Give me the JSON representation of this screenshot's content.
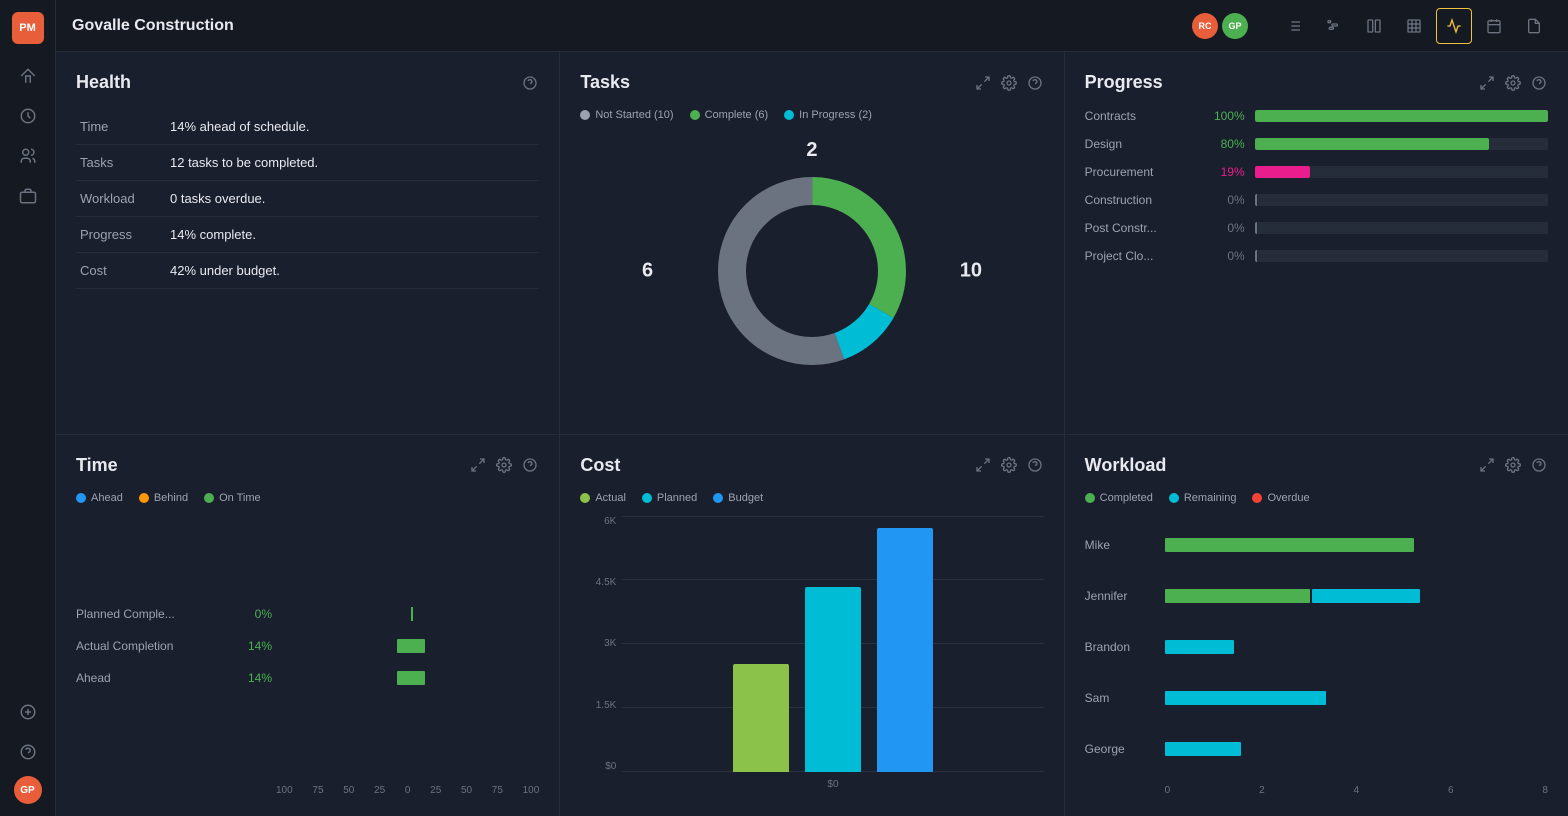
{
  "app": {
    "logo": "PM",
    "title": "Govalle Construction"
  },
  "header": {
    "title": "Govalle Construction",
    "avatars": [
      {
        "initials": "RC",
        "color": "avatar-orange"
      },
      {
        "initials": "GP",
        "color": "avatar-green"
      }
    ],
    "tools": [
      {
        "id": "list",
        "label": "list-view",
        "active": false
      },
      {
        "id": "gantt",
        "label": "gantt-view",
        "active": false
      },
      {
        "id": "board",
        "label": "board-view",
        "active": false
      },
      {
        "id": "table",
        "label": "table-view",
        "active": false
      },
      {
        "id": "pulse",
        "label": "pulse-view",
        "active": true
      },
      {
        "id": "calendar",
        "label": "calendar-view",
        "active": false
      },
      {
        "id": "docs",
        "label": "docs-view",
        "active": false
      }
    ]
  },
  "health": {
    "title": "Health",
    "rows": [
      {
        "label": "Time",
        "value": "14% ahead of schedule."
      },
      {
        "label": "Tasks",
        "value": "12 tasks to be completed."
      },
      {
        "label": "Workload",
        "value": "0 tasks overdue."
      },
      {
        "label": "Progress",
        "value": "14% complete."
      },
      {
        "label": "Cost",
        "value": "42% under budget."
      }
    ]
  },
  "tasks": {
    "title": "Tasks",
    "legend": [
      {
        "label": "Not Started (10)",
        "color": "#9ca3af"
      },
      {
        "label": "Complete (6)",
        "color": "#4caf50"
      },
      {
        "label": "In Progress (2)",
        "color": "#00bcd4"
      }
    ],
    "donut": {
      "not_started": 10,
      "complete": 6,
      "in_progress": 2,
      "total": 18,
      "labels": {
        "left": "6",
        "right": "10",
        "top": "2"
      }
    }
  },
  "progress": {
    "title": "Progress",
    "rows": [
      {
        "label": "Contracts",
        "pct": "100%",
        "pct_class": "green",
        "bar_width": "100%",
        "bar_class": "bar-green"
      },
      {
        "label": "Design",
        "pct": "80%",
        "pct_class": "green",
        "bar_width": "80%",
        "bar_class": "bar-green"
      },
      {
        "label": "Procurement",
        "pct": "19%",
        "pct_class": "pink",
        "bar_width": "19%",
        "bar_class": "bar-pink"
      },
      {
        "label": "Construction",
        "pct": "0%",
        "pct_class": "grey",
        "bar_width": "0%",
        "bar_class": "tick"
      },
      {
        "label": "Post Constr...",
        "pct": "0%",
        "pct_class": "grey",
        "bar_width": "0%",
        "bar_class": "tick"
      },
      {
        "label": "Project Clo...",
        "pct": "0%",
        "pct_class": "grey",
        "bar_width": "0%",
        "bar_class": "tick"
      }
    ]
  },
  "time": {
    "title": "Time",
    "legend": [
      {
        "label": "Ahead",
        "color": "#2196f3"
      },
      {
        "label": "Behind",
        "color": "#ff9800"
      },
      {
        "label": "On Time",
        "color": "#4caf50"
      }
    ],
    "rows": [
      {
        "label": "Planned Comple...",
        "pct": "0%",
        "bar_right_pct": 0
      },
      {
        "label": "Actual Completion",
        "pct": "14%",
        "bar_right_pct": 14
      },
      {
        "label": "Ahead",
        "pct": "14%",
        "bar_right_pct": 14
      }
    ],
    "x_axis": [
      "100",
      "75",
      "50",
      "25",
      "0",
      "25",
      "50",
      "75",
      "100"
    ]
  },
  "cost": {
    "title": "Cost",
    "legend": [
      {
        "label": "Actual",
        "color": "#8bc34a"
      },
      {
        "label": "Planned",
        "color": "#00bcd4"
      },
      {
        "label": "Budget",
        "color": "#2196f3"
      }
    ],
    "y_axis": [
      "6K",
      "4.5K",
      "3K",
      "1.5K",
      "$0"
    ],
    "bars": {
      "actual_height": 42,
      "planned_height": 72,
      "budget_height": 95
    }
  },
  "workload": {
    "title": "Workload",
    "legend": [
      {
        "label": "Completed",
        "color": "#4caf50"
      },
      {
        "label": "Remaining",
        "color": "#00bcd4"
      },
      {
        "label": "Overdue",
        "color": "#f44336"
      }
    ],
    "rows": [
      {
        "label": "Mike",
        "completed": 65,
        "remaining": 0,
        "overdue": 0
      },
      {
        "label": "Jennifer",
        "completed": 38,
        "remaining": 28,
        "overdue": 0
      },
      {
        "label": "Brandon",
        "completed": 0,
        "remaining": 18,
        "overdue": 0
      },
      {
        "label": "Sam",
        "completed": 0,
        "remaining": 42,
        "overdue": 0
      },
      {
        "label": "George",
        "completed": 0,
        "remaining": 20,
        "overdue": 0
      }
    ],
    "x_axis": [
      "0",
      "2",
      "4",
      "6",
      "8"
    ]
  }
}
